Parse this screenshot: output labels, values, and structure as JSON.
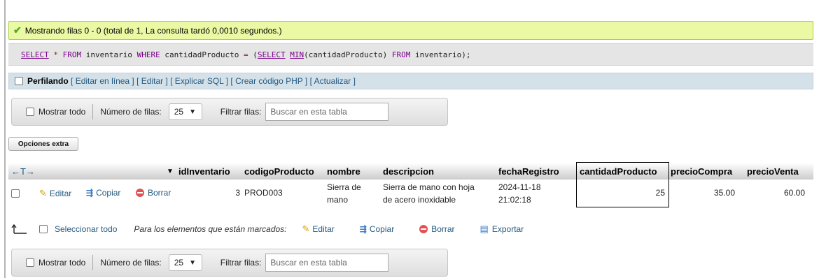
{
  "success": {
    "text": "Mostrando filas 0 - 0 (total de 1, La consulta tardó 0,0010 segundos.)"
  },
  "sql": {
    "parts": [
      "SELECT",
      " * ",
      "FROM",
      " inventario ",
      "WHERE",
      " cantidadProducto ",
      "=",
      " (",
      "SELECT",
      " ",
      "MIN",
      "(cantidadProducto) ",
      "FROM",
      " inventario);"
    ]
  },
  "profiling": {
    "label": "Perfilando",
    "links": [
      "[ Editar en línea ]",
      "[ Editar ]",
      "[ Explicar SQL ]",
      "[ Crear código PHP ]",
      "[ Actualizar ]"
    ]
  },
  "nav": {
    "show_all": "Mostrar todo",
    "rows_label": "Número de filas:",
    "rows_value": "25",
    "filter_label": "Filtrar filas:",
    "filter_placeholder": "Buscar en esta tabla"
  },
  "extra_options": "Opciones extra",
  "table": {
    "arrows": "←T→",
    "sort_indicator": "▼",
    "columns": [
      "idInventario",
      "codigoProducto",
      "nombre",
      "descripcion",
      "fechaRegistro",
      "cantidadProducto",
      "precioCompra",
      "precioVenta"
    ],
    "row": {
      "edit": "Editar",
      "copy": "Copiar",
      "delete": "Borrar",
      "idInventario": "3",
      "codigoProducto": "PROD003",
      "nombre_1": "Sierra de",
      "nombre_2": "mano",
      "descripcion_1": "Sierra de mano con hoja",
      "descripcion_2": "de acero inoxidable",
      "fecha_1": "2024-11-18",
      "fecha_2": "21:02:18",
      "cantidadProducto": "25",
      "precioCompra": "35.00",
      "precioVenta": "60.00"
    }
  },
  "bulk": {
    "select_all": "Seleccionar todo",
    "for_marked": "Para los elementos que están marcados:",
    "edit": "Editar",
    "copy": "Copiar",
    "delete": "Borrar",
    "export": "Exportar"
  },
  "colors": {
    "success_bg": "#ebf8a4",
    "link": "#235a81",
    "sql_keyword": "#770088"
  }
}
